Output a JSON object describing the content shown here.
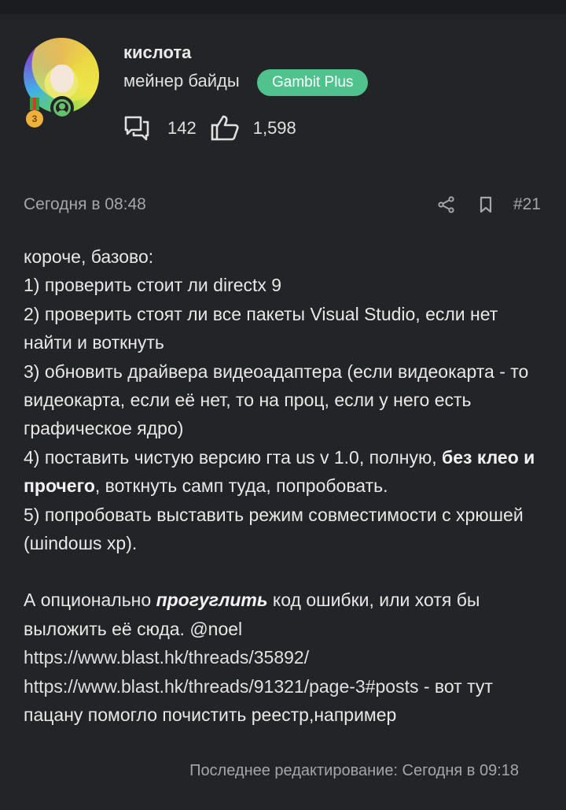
{
  "user": {
    "name": "кислота",
    "title": "мейнер байды",
    "badge": "Gambit Plus",
    "medal_level": "3",
    "messages_count": "142",
    "reactions_count": "1,598"
  },
  "post": {
    "date": "Сегодня в 08:48",
    "number": "#21",
    "lines": {
      "l0": "короче, базово:",
      "l1": "1) проверить стоит ли directx 9",
      "l2": "2) проверить стоят ли все пакеты Visual Studio, если нет найти и воткнуть",
      "l3": "3) обновить драйвера видеоадаптера (если видеокарта - то видеокарта, если её нет, то на проц, если у него есть графическое ядро)",
      "l4a": "4) поставить чистую версию гта us v 1.0, полную, ",
      "l4b": "без клео и прочего",
      "l4c": ", воткнуть самп туда, попробовать.",
      "l5": "5) попробовать выставить режим совместимости с хрюшей (шindoшs xp).",
      "p2a": "А опционально ",
      "p2b": "прогуглить",
      "p2c": " код ошибки, или хотя бы выложить её сюда. ",
      "mention": "@noel",
      "link1": "https://www.blast.hk/threads/35892/",
      "link2": "https://www.blast.hk/threads/91321/page-3#posts",
      "tail": " - вот тут пацану помогло почистить реестр,например"
    },
    "edited": "Последнее редактирование: Сегодня в 09:18"
  },
  "colors": {
    "background": "#232427",
    "badge": "#4fc28e",
    "online": "#67c16a",
    "muted_text": "#a3a6ab"
  },
  "icons": [
    "comments-icon",
    "like-icon",
    "share-icon",
    "bookmark-icon",
    "online-status-icon",
    "medal-icon"
  ]
}
